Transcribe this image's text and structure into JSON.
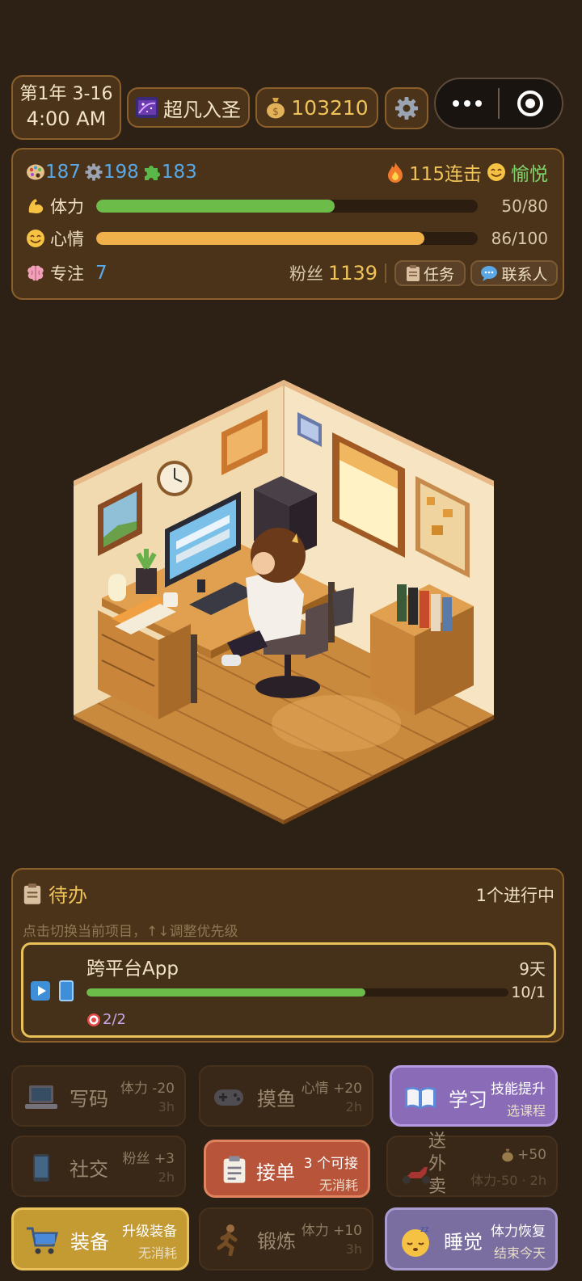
{
  "topbar": {
    "date_line1": "第1年 3-16",
    "date_line2": "4:00 AM",
    "rank": "超凡入圣",
    "money": "103210"
  },
  "stats": {
    "skill1": "187",
    "skill2": "198",
    "skill3": "183",
    "combo": "115连击",
    "mood_state": "愉悦",
    "stamina_label": "体力",
    "stamina_value": "50/80",
    "stamina_fraction": 0.625,
    "mood_label": "心情",
    "mood_value": "86/100",
    "mood_fraction": 0.86,
    "focus_label": "专注",
    "focus_value": "7",
    "fans_label": "粉丝",
    "fans_value": "1139",
    "task_btn": "任务",
    "contacts_btn": "联系人"
  },
  "todo": {
    "title": "待办",
    "count": "1个进行中",
    "hint": "点击切换当前项目，↑↓调整优先级",
    "task": {
      "name": "跨平台App",
      "days": "9天",
      "date": "10/1",
      "goal": "2/2",
      "progress": 0.66
    }
  },
  "actions": [
    {
      "name": "写码",
      "s1": "体力 -20",
      "s2": "3h",
      "icon": "laptop-icon"
    },
    {
      "name": "摸鱼",
      "s1": "心情 +20",
      "s2": "2h",
      "icon": "gamepad-icon"
    },
    {
      "name": "学习",
      "s1": "技能提升",
      "s2": "选课程",
      "icon": "book-icon"
    },
    {
      "name": "社交",
      "s1": "粉丝 +3",
      "s2": "2h",
      "icon": "phone-icon"
    },
    {
      "name": "接单",
      "s1": "3 个可接",
      "s2": "无消耗",
      "icon": "clipboard-icon"
    },
    {
      "name": "送外卖",
      "s1": "+50",
      "s2": "体力-50 · 2h",
      "icon": "scooter-icon"
    },
    {
      "name": "装备",
      "s1": "升级装备",
      "s2": "无消耗",
      "icon": "cart-icon"
    },
    {
      "name": "锻炼",
      "s1": "体力 +10",
      "s2": "3h",
      "icon": "runner-icon"
    },
    {
      "name": "睡觉",
      "s1": "体力恢复",
      "s2": "结束今天",
      "icon": "sleep-icon"
    }
  ]
}
